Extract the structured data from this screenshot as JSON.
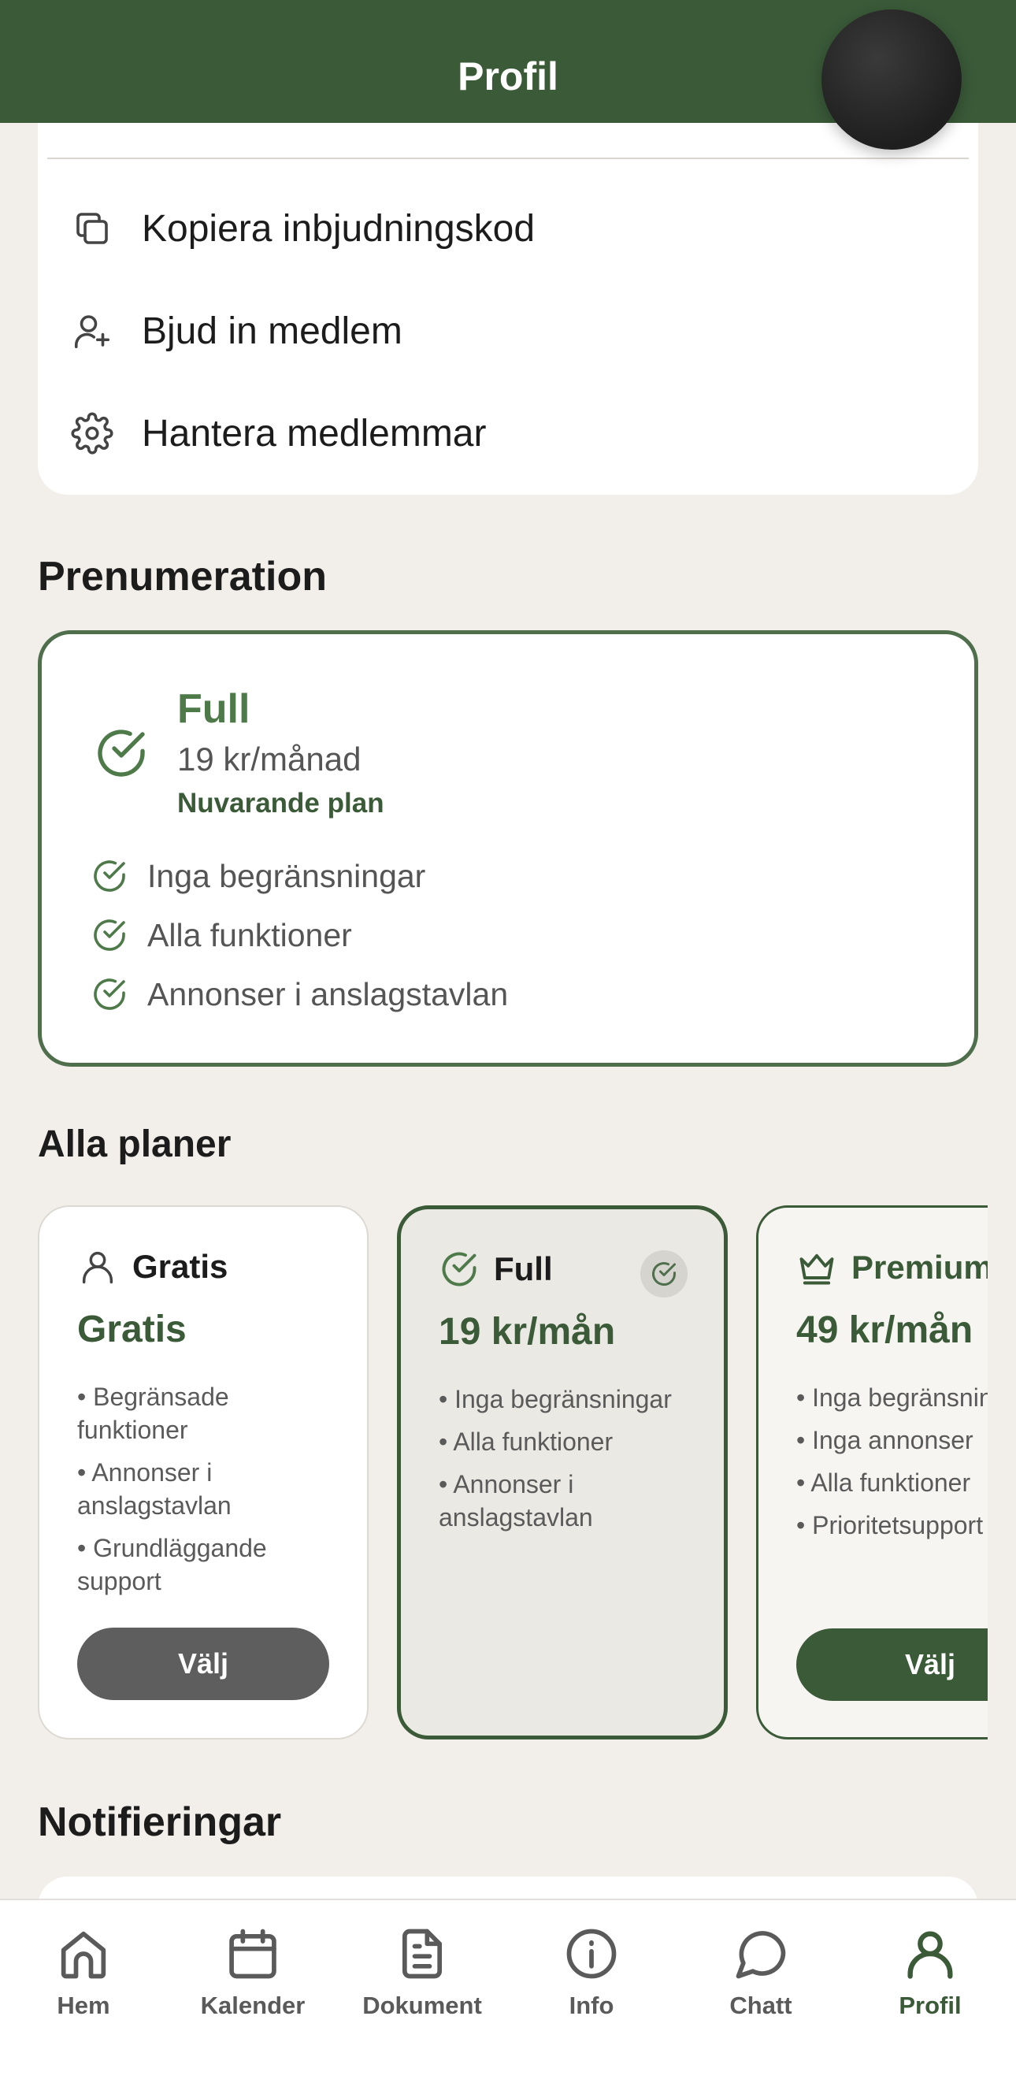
{
  "header": {
    "title": "Profil"
  },
  "menu": {
    "items": [
      {
        "label": "Kopiera inbjudningskod",
        "icon": "copy-icon"
      },
      {
        "label": "Bjud in medlem",
        "icon": "user-plus-icon"
      },
      {
        "label": "Hantera medlemmar",
        "icon": "gear-icon"
      }
    ]
  },
  "subscription": {
    "section_title": "Prenumeration",
    "current": {
      "name": "Full",
      "price": "19 kr/månad",
      "status": "Nuvarande plan",
      "features": [
        "Inga begränsningar",
        "Alla funktioner",
        "Annonser i anslagstavlan"
      ]
    }
  },
  "plans": {
    "section_title": "Alla planer",
    "items": [
      {
        "name": "Gratis",
        "price": "Gratis",
        "features": [
          "• Begränsade funktioner",
          "• Annonser i anslagstavlan",
          "• Grundläggande support"
        ],
        "button": "Välj"
      },
      {
        "name": "Full",
        "price": "19 kr/mån",
        "features": [
          "• Inga begränsningar",
          "• Alla funktioner",
          "• Annonser i anslagstavlan"
        ]
      },
      {
        "name": "Premium",
        "price": "49 kr/mån",
        "features": [
          "• Inga begränsningar",
          "• Inga annonser",
          "• Alla funktioner",
          "• Prioritetsupport"
        ],
        "button": "Välj"
      }
    ]
  },
  "notifications": {
    "section_title": "Notifieringar"
  },
  "tabbar": {
    "tabs": [
      {
        "label": "Hem",
        "icon": "home-icon"
      },
      {
        "label": "Kalender",
        "icon": "calendar-icon"
      },
      {
        "label": "Dokument",
        "icon": "document-icon"
      },
      {
        "label": "Info",
        "icon": "info-icon"
      },
      {
        "label": "Chatt",
        "icon": "chat-icon"
      },
      {
        "label": "Profil",
        "icon": "profile-icon",
        "active": true
      }
    ]
  },
  "colors": {
    "brand": "#3a5a38",
    "background": "#f2efea",
    "accent_light": "#4e7a4a"
  }
}
